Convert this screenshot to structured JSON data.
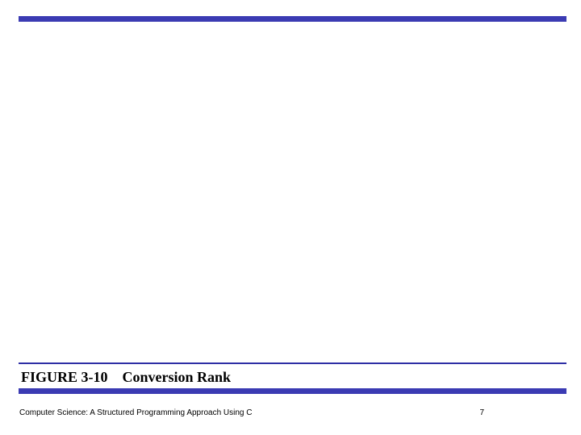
{
  "caption": {
    "label": "FIGURE 3-10",
    "title": "Conversion Rank"
  },
  "footer": {
    "book": "Computer Science: A Structured Programming Approach Using C",
    "page": "7"
  }
}
